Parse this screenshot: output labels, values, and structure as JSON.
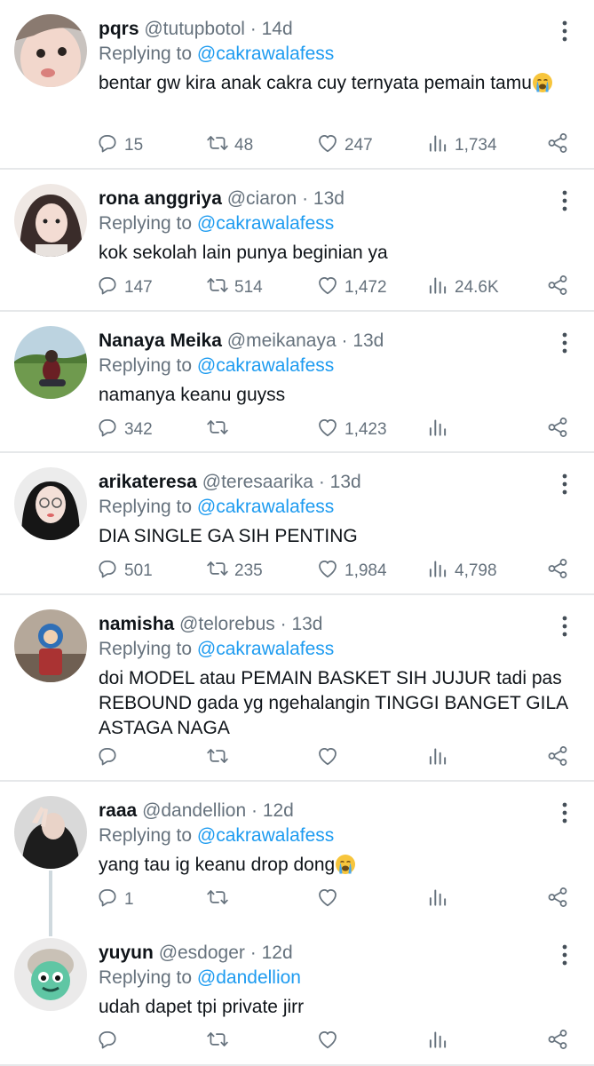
{
  "replies": [
    {
      "name": "pqrs",
      "handle": "@tutupbotol",
      "time": "14d",
      "replying_label": "Replying to",
      "replying_to": "@cakrawalafess",
      "text": "bentar gw kira anak cakra cuy ternyata pemain tamu",
      "emoji": "loudly-crying-face",
      "stats": {
        "replies": "15",
        "retweets": "48",
        "likes": "247",
        "views": "1,734"
      }
    },
    {
      "name": "rona anggriya",
      "handle": "@ciaron",
      "time": "13d",
      "replying_label": "Replying to",
      "replying_to": "@cakrawalafess",
      "text": "kok sekolah lain punya beginian ya",
      "stats": {
        "replies": "147",
        "retweets": "514",
        "likes": "1,472",
        "views": "24.6K"
      }
    },
    {
      "name": "Nanaya Meika",
      "handle": "@meikanaya",
      "time": "13d",
      "replying_label": "Replying to",
      "replying_to": "@cakrawalafess",
      "text": "namanya keanu guyss",
      "stats": {
        "replies": "342",
        "retweets": "",
        "likes": "1,423",
        "views": ""
      }
    },
    {
      "name": "arikateresa",
      "handle": "@teresaarika",
      "time": "13d",
      "replying_label": "Replying to",
      "replying_to": "@cakrawalafess",
      "text": "DIA SINGLE GA SIH PENTING",
      "stats": {
        "replies": "501",
        "retweets": "235",
        "likes": "1,984",
        "views": "4,798"
      }
    },
    {
      "name": "namisha",
      "handle": "@telorebus",
      "time": "13d",
      "replying_label": "Replying to",
      "replying_to": "@cakrawalafess",
      "text": "doi MODEL atau PEMAIN BASKET SIH JUJUR tadi pas REBOUND gada yg ngehalangin TINGGI BANGET GILA ASTAGA NAGA",
      "stats": {
        "replies": "",
        "retweets": "",
        "likes": "",
        "views": ""
      }
    },
    {
      "name": "raaa",
      "handle": "@dandellion",
      "time": "12d",
      "replying_label": "Replying to",
      "replying_to": "@cakrawalafess",
      "text": "yang tau ig keanu drop dong",
      "emoji": "loudly-crying-face",
      "stats": {
        "replies": "1",
        "retweets": "",
        "likes": "",
        "views": ""
      }
    },
    {
      "name": "yuyun",
      "handle": "@esdoger",
      "time": "12d",
      "replying_label": "Replying to",
      "replying_to": "@dandellion",
      "text": "udah dapet tpi private jirr",
      "stats": {
        "replies": "",
        "retweets": "",
        "likes": "",
        "views": ""
      }
    }
  ],
  "dot_separator": "·",
  "icons": {
    "reply": "speech-bubble-icon",
    "retweet": "retweet-icon",
    "like": "heart-icon",
    "views": "bar-chart-icon",
    "share": "share-icon",
    "more": "more-vertical-icon"
  },
  "colors": {
    "text": "#0f1419",
    "muted": "#66727d",
    "link": "#1d9bf0",
    "divider": "#e6e8ea"
  }
}
